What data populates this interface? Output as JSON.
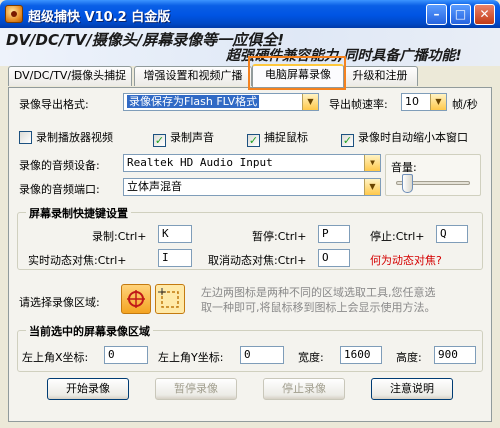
{
  "window": {
    "title": "超级捕快 V10.2 白金版",
    "min_glyph": "–",
    "max_glyph": "□",
    "close_glyph": "✕"
  },
  "banner": {
    "line1": "DV/DC/TV/摄像头/屏幕录像等一应俱全!",
    "line2": "超强硬件兼容能力,同时具备广播功能!"
  },
  "tabs": [
    {
      "label": "DV/DC/TV/摄像头捕捉"
    },
    {
      "label": "增强设置和视频广播"
    },
    {
      "label": "电脑屏幕录像"
    },
    {
      "label": "升级和注册"
    }
  ],
  "export": {
    "format_label": "录像导出格式:",
    "format_value": "录像保存为Flash FLV格式",
    "fps_label": "导出帧速率:",
    "fps_value": "10",
    "fps_unit": "帧/秒"
  },
  "checkboxes": [
    {
      "label": "录制播放器视频",
      "checked": false
    },
    {
      "label": "录制声音",
      "checked": true
    },
    {
      "label": "捕捉鼠标",
      "checked": true
    },
    {
      "label": "录像时自动缩小本窗口",
      "checked": true
    }
  ],
  "check_glyph": "✓",
  "audio": {
    "device_label": "录像的音频设备:",
    "device_value": "Realtek HD Audio Input",
    "port_label": "录像的音频端口:",
    "port_value": "立体声混音",
    "volume_label": "音量:",
    "volume_level": 0.1
  },
  "hotkeys": {
    "group_title": "屏幕录制快捷键设置",
    "record_label": "录制:Ctrl+",
    "record_key": "K",
    "pause_label": "暂停:Ctrl+",
    "pause_key": "P",
    "stop_label": "停止:Ctrl+",
    "stop_key": "Q",
    "focus_label": "实时动态对焦:Ctrl+",
    "focus_key": "I",
    "cancel_focus_label": "取消动态对焦:Ctrl+",
    "cancel_focus_key": "O",
    "what_is_focus": "何为动态对焦?"
  },
  "region": {
    "label": "请选择录像区域:",
    "hint_line1": "左边两图标是两种不同的区域选取工具,您任意选",
    "hint_line2": "取一种即可,将鼠标移到图标上会显示使用方法。"
  },
  "current_region": {
    "group_title": "当前选中的屏幕录像区域",
    "x_label": "左上角X坐标:",
    "x_value": "0",
    "y_label": "左上角Y坐标:",
    "y_value": "0",
    "width_label": "宽度:",
    "width_value": "1600",
    "height_label": "高度:",
    "height_value": "900"
  },
  "buttons": {
    "start": "开始录像",
    "pause": "暂停录像",
    "stop": "停止录像",
    "notes": "注意说明"
  },
  "colors": {
    "accent_highlight": "#f4821f",
    "link_red": "#d40000",
    "selection_blue": "#316ac5"
  }
}
